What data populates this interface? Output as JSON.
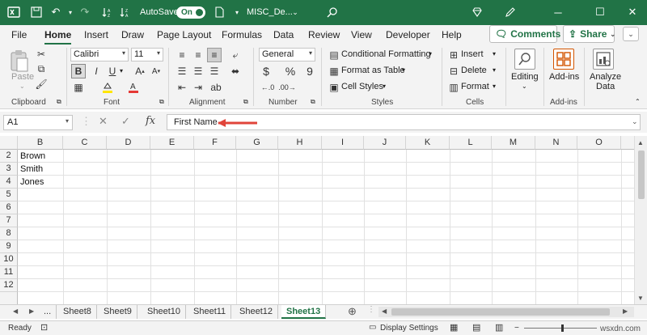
{
  "titlebar": {
    "autosave_label": "AutoSave",
    "autosave_state": "On",
    "filename": "MISC_De..."
  },
  "tabs": [
    "File",
    "Home",
    "Insert",
    "Draw",
    "Page Layout",
    "Formulas",
    "Data",
    "Review",
    "View",
    "Developer",
    "Help"
  ],
  "actions": {
    "comments": "Comments",
    "share": "Share"
  },
  "ribbon": {
    "clipboard": {
      "paste": "Paste",
      "label": "Clipboard"
    },
    "font": {
      "name": "Calibri",
      "size": "11",
      "bold": "B",
      "italic": "I",
      "underline": "U",
      "label": "Font"
    },
    "alignment": {
      "label": "Alignment"
    },
    "number": {
      "format": "General",
      "currency": "$",
      "percent": "%",
      "comma": "9",
      "label": "Number"
    },
    "styles": {
      "conditional": "Conditional Formatting",
      "table": "Format as Table",
      "cell": "Cell Styles",
      "label": "Styles"
    },
    "cells": {
      "insert": "Insert",
      "delete": "Delete",
      "format": "Format",
      "label": "Cells"
    },
    "editing": {
      "label": "Editing"
    },
    "addins": {
      "label": "Add-ins",
      "group": "Add-ins"
    },
    "analyze": {
      "line1": "Analyze",
      "line2": "Data"
    }
  },
  "formula_bar": {
    "name_box": "A1",
    "fx": "fx",
    "formula": "First Name"
  },
  "grid": {
    "columns": [
      "B",
      "C",
      "D",
      "E",
      "F",
      "G",
      "H",
      "I",
      "J",
      "K",
      "L",
      "M",
      "N",
      "O"
    ],
    "rows": [
      "2",
      "3",
      "4",
      "5",
      "6",
      "7",
      "8",
      "9",
      "10",
      "11",
      "12"
    ],
    "cells": [
      "Brown",
      "Smith",
      "Jones"
    ]
  },
  "sheets": {
    "ellipsis": "...",
    "tabs": [
      "Sheet8",
      "Sheet9",
      "Sheet10",
      "Sheet11",
      "Sheet12",
      "Sheet13"
    ],
    "active": "Sheet13"
  },
  "status": {
    "ready": "Ready",
    "display": "Display Settings",
    "watermark": "wsxdn.com"
  },
  "colors": {
    "accent": "#217346",
    "arrow": "#e0443a"
  }
}
